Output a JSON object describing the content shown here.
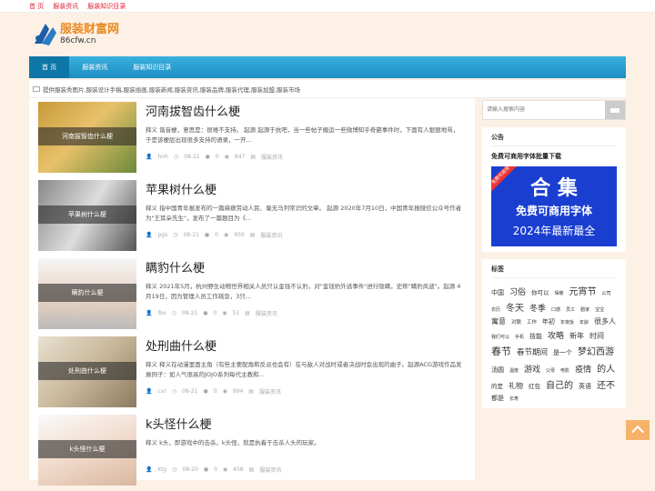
{
  "topbar": {
    "links": [
      "首 页",
      "服装资讯",
      "服装知识目录"
    ]
  },
  "logo": {
    "name": "服装财富网",
    "domain": "86cfw.cn"
  },
  "nav": {
    "items": [
      "首 页",
      "服装资讯",
      "服装知识目录"
    ]
  },
  "notice": {
    "text": "提供服装秀图片,服装设计手稿,服装插画,服装新闻,服装资讯,服装品牌,服装代理,服装加盟,服装市场"
  },
  "posts": [
    {
      "title": "河南拔智齿什么梗",
      "thumb_caption": "河南拔智齿什么梗",
      "excerpt": "释义 谐音梗，意思是：很难不支持。 起源 起源于抗吧，当一些帖子搬运一些微博知乎奇葩事件时，下面有人狠狠地骂，于是该梗层出现很多支持的语录，一开...",
      "author": "hnh",
      "date": "08-21",
      "comments": "0",
      "views": "847",
      "category": "服装资讯"
    },
    {
      "title": "苹果树什么梗",
      "thumb_caption": "苹果树什么梗",
      "excerpt": "释义 指中国青年报发布的一篇麻痹劳动人民、毫无马列常识的文章。 起源 2020年7月10日，中国青年报微信公众号作者为\"王耳朵先生\"，发布了一篇题目为《...",
      "author": "pgs",
      "date": "08-21",
      "comments": "0",
      "views": "950",
      "category": "服装资讯"
    },
    {
      "title": "瞒豹什么梗",
      "thumb_caption": "瞒豹什么梗",
      "excerpt": "释义 2021年5月，杭州野生动物世界相关人员只认金钱不认豹，对\"金钱豹外逃事件\"进行隐瞒，史称\"瞒豹风波\"。起源 4月19日，因为管理人员工作疏忽，3只...",
      "author": "lbx",
      "date": "08-21",
      "comments": "0",
      "views": "51",
      "category": "服装资讯"
    },
    {
      "title": "处刑曲什么梗",
      "thumb_caption": "处刑曲什么梗",
      "excerpt": "释义 释义在动漫里面主角（有些主要配角和反派也会有）在与敌人对战时或者决战时会出现的曲子。起源ACG游戏作品发展例子：如人气很高的JOJO系列每代主教和...",
      "author": "cxr",
      "date": "08-21",
      "comments": "0",
      "views": "994",
      "category": "服装资讯"
    },
    {
      "title": "k头怪什么梗",
      "thumb_caption": "k头怪什么梗",
      "excerpt": "释义 k头，即游戏中的击杀。k头怪，就是执着于击杀人头的玩家。",
      "author": "ktg",
      "date": "08-20",
      "comments": "0",
      "views": "458",
      "category": "服装资讯"
    }
  ],
  "sidebar": {
    "search_placeholder": "请输入搜索内容",
    "notice_title": "公告",
    "notice_sub": "免费可商用字体批量下载",
    "banner": {
      "ribbon": "免费可商用",
      "big": "合 集",
      "line2": "免费可商用字体",
      "line3": "2024年最新最全"
    },
    "tags_title": "标签",
    "tags": [
      {
        "t": "中国",
        "s": 7
      },
      {
        "t": "习俗",
        "s": 9
      },
      {
        "t": "你可以",
        "s": 6.5
      },
      {
        "t": "保暖",
        "s": 5
      },
      {
        "t": "元宵节",
        "s": 10
      },
      {
        "t": "公司",
        "s": 5
      },
      {
        "t": "衣历",
        "s": 5
      },
      {
        "t": "冬天",
        "s": 10
      },
      {
        "t": "冬季",
        "s": 9
      },
      {
        "t": "口感",
        "s": 5
      },
      {
        "t": "员工",
        "s": 5
      },
      {
        "t": "腊家",
        "s": 5
      },
      {
        "t": "宝宝",
        "s": 5
      },
      {
        "t": "寓意",
        "s": 8
      },
      {
        "t": "对联",
        "s": 5.5
      },
      {
        "t": "工作",
        "s": 5.5
      },
      {
        "t": "年初",
        "s": 7
      },
      {
        "t": "年夜饭",
        "s": 5
      },
      {
        "t": "年龄",
        "s": 5
      },
      {
        "t": "很多人",
        "s": 8
      },
      {
        "t": "我们可以",
        "s": 5
      },
      {
        "t": "手机",
        "s": 5
      },
      {
        "t": "技能",
        "s": 7
      },
      {
        "t": "攻略",
        "s": 9
      },
      {
        "t": "新年",
        "s": 8
      },
      {
        "t": "时间",
        "s": 8
      },
      {
        "t": "春节",
        "s": 11
      },
      {
        "t": "春节期间",
        "s": 8.5
      },
      {
        "t": "是一个",
        "s": 7
      },
      {
        "t": "梦幻西游",
        "s": 10
      },
      {
        "t": "汤圆",
        "s": 7
      },
      {
        "t": "温度",
        "s": 5
      },
      {
        "t": "游戏",
        "s": 9
      },
      {
        "t": "父母",
        "s": 5
      },
      {
        "t": "电影",
        "s": 5
      },
      {
        "t": "疫情",
        "s": 9
      },
      {
        "t": "的人",
        "s": 10
      },
      {
        "t": "的是",
        "s": 6.5
      },
      {
        "t": "礼物",
        "s": 8
      },
      {
        "t": "红包",
        "s": 6.5
      },
      {
        "t": "自己的",
        "s": 10
      },
      {
        "t": "英语",
        "s": 7
      },
      {
        "t": "还不",
        "s": 10
      },
      {
        "t": "都是",
        "s": 7
      },
      {
        "t": "长寿",
        "s": 5
      }
    ]
  },
  "colors": {
    "accent": "#1d8ec2",
    "topbar_link": "#dd2233",
    "background": "#fdf1e6",
    "banner": "#1a3fd0"
  }
}
